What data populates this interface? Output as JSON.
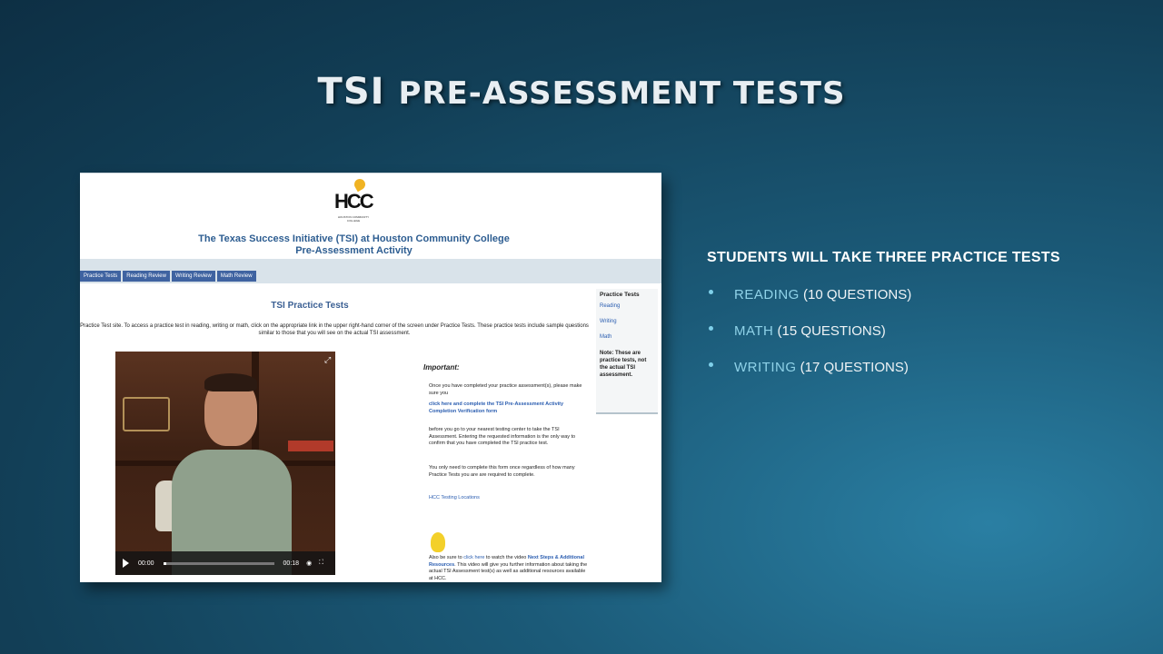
{
  "slide": {
    "title_main": "TSI",
    "title_rest": "PRE-ASSESSMENT TESTS"
  },
  "screenshot": {
    "logo_text": "HCC",
    "logo_sub": "HOUSTON COMMUNITY COLLEGE",
    "site_title_line1": "The Texas Success Initiative (TSI) at Houston Community College",
    "site_title_line2": "Pre-Assessment Activity",
    "nav_tabs": [
      "Practice Tests",
      "Reading Review",
      "Writing Review",
      "Math Review"
    ],
    "content_title": "TSI Practice Tests",
    "intro_text": "Practice Test site. To access a practice test in reading, writing or math, click on the appropriate link in the upper right-hand corner of the screen under Practice Tests. These practice tests include sample questions similar to those that you will see on the actual TSI assessment.",
    "video": {
      "current_time": "00:00",
      "duration": "00:18",
      "progress": 0.0
    },
    "important_heading": "Important:",
    "important_p1": "Once you have completed your practice assessment(s), please make sure you",
    "important_link": "click here and complete the TSI Pre-Assessment Activity Completion Verification form",
    "important_p2": "before you go to your nearest testing center to take the TSI Assessment. Entering the requested information is the only way to confirm that you have completed the TSI practice test.",
    "important_p3": "You only need to complete this form once regardless of how many Practice Tests you are are required to complete.",
    "testing_locations_link": "HCC Testing Locations",
    "also_text_1": "Also be sure to ",
    "also_link": "click here",
    "also_text_2": " to watch the video ",
    "also_bold_link": "Next Steps & Additional Resources",
    "also_text_3": ". This video will give you further information about taking the actual TSI Assessment test(s) as well as additional resources available at HCC.",
    "sidebar": {
      "heading": "Practice Tests",
      "items": [
        "Reading",
        "Writing",
        "Math"
      ],
      "note": "Note: These are practice tests, not the actual TSI assessment."
    }
  },
  "bullets": {
    "heading": "STUDENTS WILL TAKE THREE PRACTICE TESTS",
    "items": [
      {
        "key": "READING",
        "rest": " (10 QUESTIONS)"
      },
      {
        "key": "MATH",
        "rest": " (15 QUESTIONS)"
      },
      {
        "key": "WRITING",
        "rest": " (17 QUESTIONS)"
      }
    ]
  },
  "colors": {
    "accent": "#8fd2e8",
    "site_link": "#2a5db0",
    "nav_tab": "#3f63a1"
  }
}
